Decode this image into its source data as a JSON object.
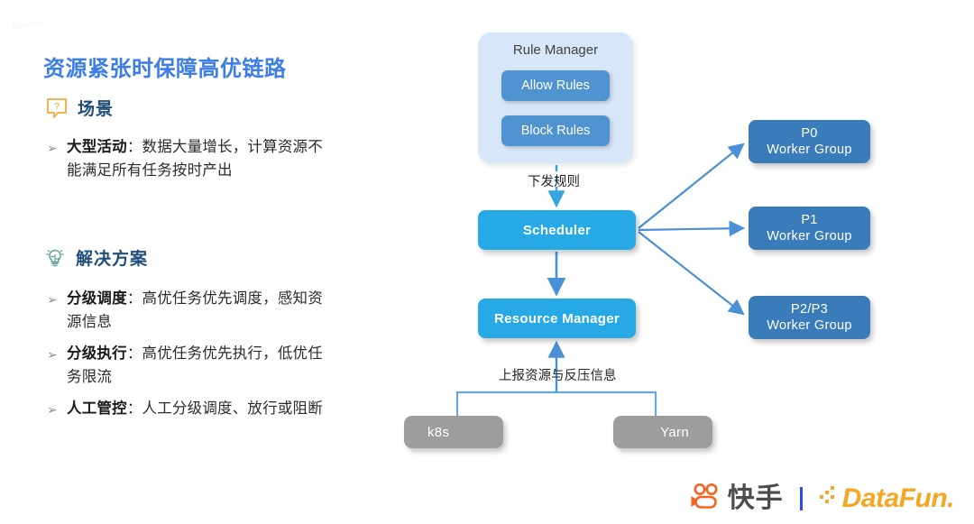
{
  "slide": {
    "title": "资源紧张时保障高优链路",
    "watermark": "DataFun"
  },
  "sections": [
    {
      "id": "scenario",
      "icon": "question-bubble-icon",
      "label": "场景",
      "bullets": [
        {
          "marker": "➢",
          "strong": "大型活动",
          "sep": "：",
          "text": "数据大量增长，计算资源不能满足所有任务按时产出"
        }
      ]
    },
    {
      "id": "solution",
      "icon": "lightbulb-circuit-icon",
      "label": "解决方案",
      "bullets": [
        {
          "marker": "➢",
          "strong": "分级调度",
          "sep": "：",
          "text": "高优任务优先调度，感知资源信息"
        },
        {
          "marker": "➢",
          "strong": "分级执行",
          "sep": "：",
          "text": "高优任务优先执行，低优任务限流"
        },
        {
          "marker": "➢",
          "strong": "人工管控",
          "sep": "：",
          "text": "人工分级调度、放行或阻断"
        }
      ]
    }
  ],
  "diagram": {
    "rule_manager": {
      "title": "Rule Manager",
      "chips": [
        {
          "label": "Allow Rules"
        },
        {
          "label": "Block Rules"
        }
      ]
    },
    "nodes": {
      "scheduler": "Scheduler",
      "resource_manager": "Resource Manager"
    },
    "worker_groups": [
      {
        "line1": "P0",
        "line2": "Worker Group"
      },
      {
        "line1": "P1",
        "line2": "Worker Group"
      },
      {
        "line1": "P2/P3",
        "line2": "Worker Group"
      }
    ],
    "infra": [
      {
        "label": "k8s"
      },
      {
        "label": "Yarn"
      }
    ],
    "edge_labels": {
      "push_rules": "下发规则",
      "report_resources": "上报资源与反压信息"
    }
  },
  "footer": {
    "kuaishou_text": "快手",
    "datafun_text": "DataFun."
  },
  "colors": {
    "title_blue": "#3d7de8",
    "heading_navy": "#1f4e79",
    "node_blue": "#26a9e5",
    "worker_blue": "#3a7cb9",
    "panel_blue": "#d7e6f8",
    "chip_blue": "#4f94d0",
    "infra_gray": "#9d9d9d",
    "link_blue": "#4a90d6",
    "brand_orange": "#f5631e",
    "datafun_orange": "#f5a623"
  }
}
